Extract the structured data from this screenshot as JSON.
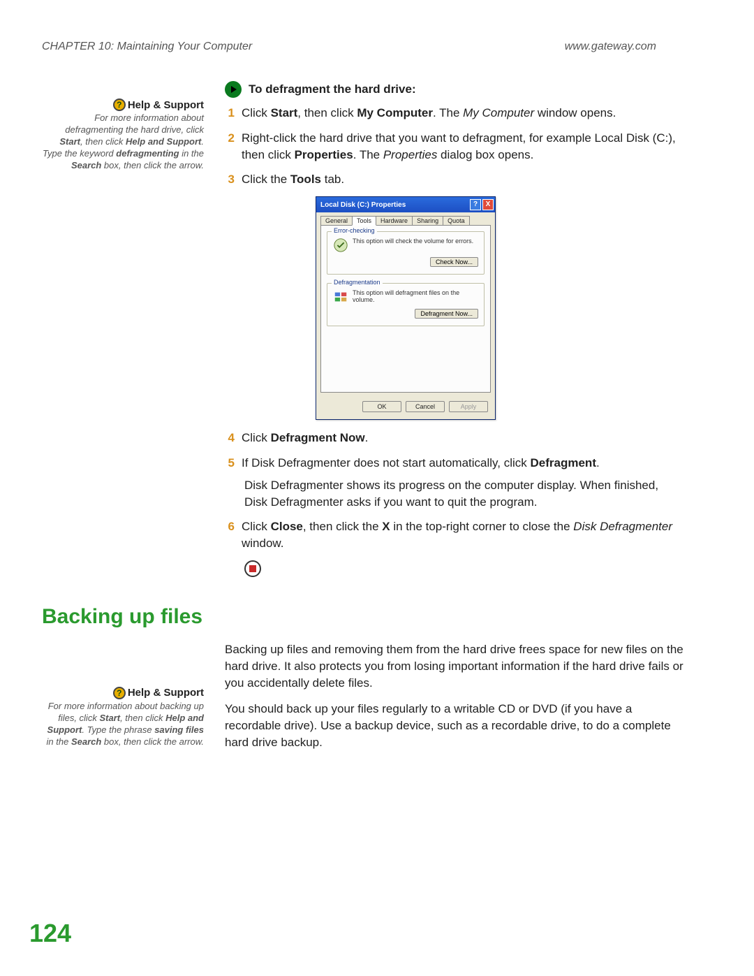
{
  "header": {
    "chapter": "CHAPTER 10: Maintaining Your Computer",
    "site": "www.gateway.com"
  },
  "sidebar": {
    "help1": {
      "title": "Help & Support",
      "line1": "For more information about defragmenting the hard drive, click ",
      "b1": "Start",
      "line2": ", then click ",
      "b2": "Help and Support",
      "line3": ". Type the keyword ",
      "b3": "defragmenting",
      "line4": " in the ",
      "b4": "Search",
      "line5": " box, then click the arrow."
    },
    "help2": {
      "title": "Help & Support",
      "line1": "For more information about backing up files, click ",
      "b1": "Start",
      "line2": ", then click ",
      "b2": "Help and Support",
      "line3": ". Type the phrase ",
      "b3": "saving files",
      "line4": " in the ",
      "b4": "Search",
      "line5": " box, then click the arrow."
    }
  },
  "main": {
    "heading": "To defragment the hard drive:",
    "steps": {
      "s1n": "1",
      "s1a": "Click ",
      "s1b": "Start",
      "s1c": ", then click ",
      "s1d": "My Computer",
      "s1e": ". The ",
      "s1f": "My Computer",
      "s1g": " window opens.",
      "s2n": "2",
      "s2a": "Right-click the hard drive that you want to defragment, for example Local Disk (C:), then click ",
      "s2b": "Properties",
      "s2c": ". The ",
      "s2d": "Properties",
      "s2e": " dialog box opens.",
      "s3n": "3",
      "s3a": "Click the ",
      "s3b": "Tools",
      "s3c": " tab.",
      "s4n": "4",
      "s4a": "Click ",
      "s4b": "Defragment Now",
      "s4c": ".",
      "s5n": "5",
      "s5a": "If Disk Defragmenter does not start automatically, click ",
      "s5b": "Defragment",
      "s5c": ".",
      "s5extra": "Disk Defragmenter shows its progress on the computer display. When finished, Disk Defragmenter asks if you want to quit the program.",
      "s6n": "6",
      "s6a": "Click ",
      "s6b": "Close",
      "s6c": ", then click the ",
      "s6d": "X",
      "s6e": " in the top-right corner to close the ",
      "s6f": "Disk Defragmenter",
      "s6g": " window."
    },
    "dialog": {
      "title": "Local Disk (C:) Properties",
      "help": "?",
      "close": "X",
      "tabs": {
        "t1": "General",
        "t2": "Tools",
        "t3": "Hardware",
        "t4": "Sharing",
        "t5": "Quota"
      },
      "fs1": {
        "legend": "Error-checking",
        "text": "This option will check the volume for errors.",
        "btn": "Check Now..."
      },
      "fs2": {
        "legend": "Defragmentation",
        "text": "This option will defragment files on the volume.",
        "btn": "Defragment Now..."
      },
      "ok": "OK",
      "cancel": "Cancel",
      "apply": "Apply"
    },
    "h2": "Backing up files",
    "p1": "Backing up files and removing them from the hard drive frees space for new files on the hard drive. It also protects you from losing important information if the hard drive fails or you accidentally delete files.",
    "p2": "You should back up your files regularly to a writable CD or DVD (if you have a recordable drive). Use a backup device, such as a recordable drive, to do a complete hard drive backup."
  },
  "pagenum": "124"
}
